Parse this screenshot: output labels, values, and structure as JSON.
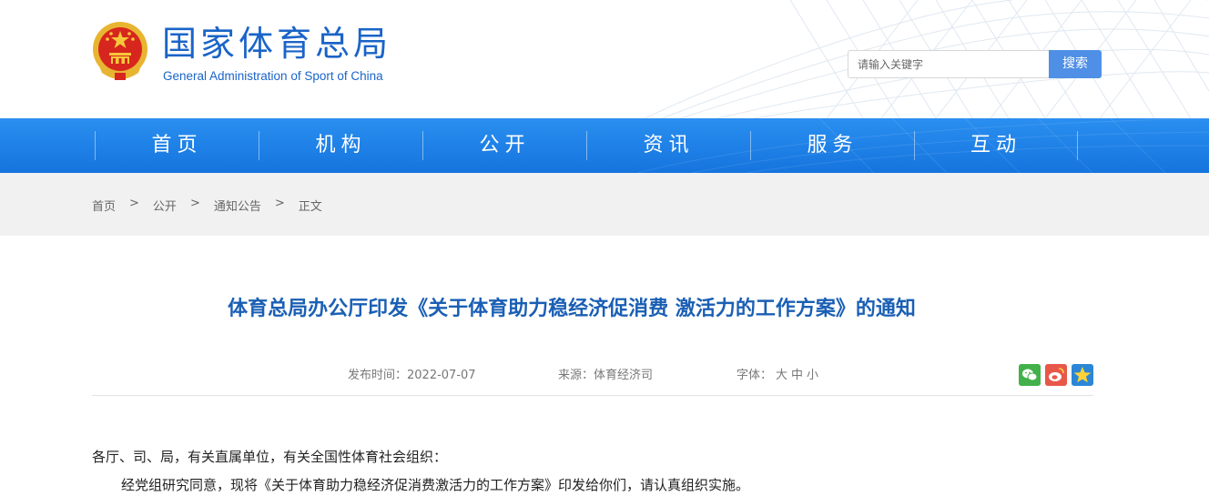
{
  "header": {
    "site_name_cn": "国家体育总局",
    "site_name_en": "General Administration of Sport of China",
    "search_placeholder": "请输入关键字",
    "search_button": "搜索"
  },
  "nav": {
    "items": [
      "首页",
      "机构",
      "公开",
      "资讯",
      "服务",
      "互动"
    ]
  },
  "breadcrumb": {
    "items": [
      "首页",
      "公开",
      "通知公告",
      "正文"
    ],
    "separator": ">"
  },
  "article": {
    "title": "体育总局办公厅印发《关于体育助力稳经济促消费 激活力的工作方案》的通知",
    "publish_time": "发布时间：2022-07-07",
    "source": "来源：体育经济司",
    "font_label": "字体：",
    "font_sizes": [
      "大",
      "中",
      "小"
    ],
    "para1": "各厅、司、局，有关直属单位，有关全国性体育社会组织：",
    "para2": "经党组研究同意，现将《关于体育助力稳经济促消费激活力的工作方案》印发给你们，请认真组织实施。"
  },
  "share": {
    "icons": [
      "wechat-icon",
      "weibo-icon",
      "qzone-icon"
    ]
  },
  "colors": {
    "brand_blue": "#1a64c8",
    "nav_blue": "#1574de",
    "title_blue": "#1a5fb4",
    "search_button": "#4f8fe6"
  }
}
